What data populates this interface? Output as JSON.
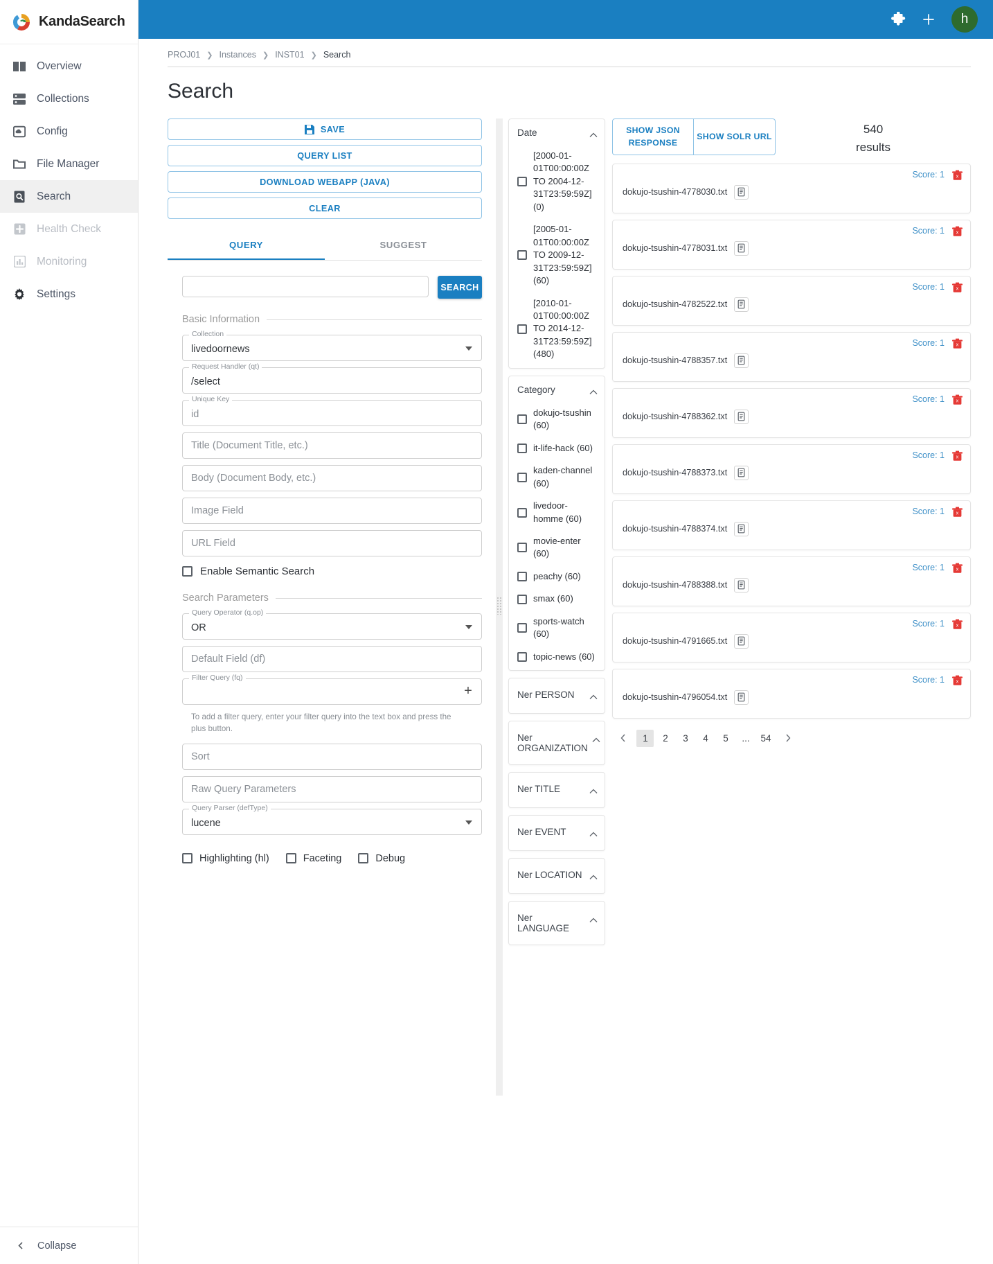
{
  "brand": {
    "name": "KandaSearch",
    "logo_icon": "kandasearch-logo-icon"
  },
  "sidebar": {
    "items": [
      {
        "label": "Overview",
        "icon": "book-icon",
        "state": "normal"
      },
      {
        "label": "Collections",
        "icon": "server-icon",
        "state": "normal"
      },
      {
        "label": "Config",
        "icon": "cloud-box-icon",
        "state": "normal"
      },
      {
        "label": "File Manager",
        "icon": "folder-icon",
        "state": "normal"
      },
      {
        "label": "Search",
        "icon": "doc-search-icon",
        "state": "active"
      },
      {
        "label": "Health Check",
        "icon": "plus-box-icon",
        "state": "disabled"
      },
      {
        "label": "Monitoring",
        "icon": "bar-chart-icon",
        "state": "disabled"
      },
      {
        "label": "Settings",
        "icon": "gear-icon",
        "state": "normal"
      }
    ],
    "collapse_label": "Collapse",
    "collapse_icon": "chevron-left-icon"
  },
  "topbar": {
    "puzzle_icon": "puzzle-piece-icon",
    "plus_icon": "plus-icon",
    "avatar_initial": "h",
    "avatar_color": "#2e6b2e",
    "bar_color": "#1a7fc1"
  },
  "breadcrumb": {
    "items": [
      "PROJ01",
      "Instances",
      "INST01",
      "Search"
    ]
  },
  "page": {
    "title": "Search"
  },
  "actions": {
    "save": "SAVE",
    "save_icon": "floppy-disk-icon",
    "query_list": "QUERY LIST",
    "download_webapp": "DOWNLOAD WEBAPP (JAVA)",
    "clear": "CLEAR"
  },
  "tabs": [
    {
      "label": "QUERY",
      "active": true
    },
    {
      "label": "SUGGEST",
      "active": false
    }
  ],
  "query_bar": {
    "input_value": "",
    "input_placeholder": "",
    "button": "SEARCH"
  },
  "sections": {
    "basic": "Basic Information",
    "params": "Search Parameters"
  },
  "basic_fields": [
    {
      "label": "Collection",
      "value": "livedoornews",
      "placeholder": "",
      "type": "select"
    },
    {
      "label": "Request Handler (qt)",
      "value": "/select",
      "placeholder": "",
      "type": "text"
    },
    {
      "label": "Unique Key",
      "value": "",
      "placeholder": "id",
      "type": "text"
    },
    {
      "label": "",
      "value": "",
      "placeholder": "Title (Document Title, etc.)",
      "type": "text"
    },
    {
      "label": "",
      "value": "",
      "placeholder": "Body (Document Body, etc.)",
      "type": "text"
    },
    {
      "label": "",
      "value": "",
      "placeholder": "Image Field",
      "type": "text"
    },
    {
      "label": "",
      "value": "",
      "placeholder": "URL Field",
      "type": "text"
    }
  ],
  "semantic_checkbox": {
    "label": "Enable Semantic Search",
    "checked": false
  },
  "param_fields": [
    {
      "label": "Query Operator (q.op)",
      "value": "OR",
      "placeholder": "",
      "type": "select"
    },
    {
      "label": "",
      "value": "",
      "placeholder": "Default Field (df)",
      "type": "text"
    },
    {
      "label": "Filter Query (fq)",
      "value": "",
      "placeholder": "",
      "type": "plus"
    },
    {
      "label": "",
      "value": "",
      "placeholder": "Sort",
      "type": "text"
    },
    {
      "label": "",
      "value": "",
      "placeholder": "Raw Query Parameters",
      "type": "text"
    },
    {
      "label": "Query Parser (defType)",
      "value": "lucene",
      "placeholder": "",
      "type": "select"
    }
  ],
  "filter_hint": "To add a filter query, enter your filter query into the text box and press the plus button.",
  "bottom_checkboxes": [
    {
      "label": "Highlighting (hl)",
      "checked": false
    },
    {
      "label": "Faceting",
      "checked": false
    },
    {
      "label": "Debug",
      "checked": false
    }
  ],
  "facets": [
    {
      "title": "Date",
      "expanded": true,
      "items": [
        {
          "label": "[2000-01-01T00:00:00Z TO 2004-12-31T23:59:59Z] (0)",
          "checked": false
        },
        {
          "label": "[2005-01-01T00:00:00Z TO 2009-12-31T23:59:59Z] (60)",
          "checked": false
        },
        {
          "label": "[2010-01-01T00:00:00Z TO 2014-12-31T23:59:59Z] (480)",
          "checked": false
        }
      ]
    },
    {
      "title": "Category",
      "expanded": true,
      "items": [
        {
          "label": "dokujo-tsushin (60)",
          "checked": false
        },
        {
          "label": "it-life-hack (60)",
          "checked": false
        },
        {
          "label": "kaden-channel (60)",
          "checked": false
        },
        {
          "label": "livedoor-homme (60)",
          "checked": false
        },
        {
          "label": "movie-enter (60)",
          "checked": false
        },
        {
          "label": "peachy (60)",
          "checked": false
        },
        {
          "label": "smax (60)",
          "checked": false
        },
        {
          "label": "sports-watch (60)",
          "checked": false
        },
        {
          "label": "topic-news (60)",
          "checked": false
        }
      ]
    },
    {
      "title": "Ner PERSON",
      "expanded": true,
      "items": []
    },
    {
      "title": "Ner ORGANIZATION",
      "expanded": true,
      "items": []
    },
    {
      "title": "Ner TITLE",
      "expanded": true,
      "items": []
    },
    {
      "title": "Ner EVENT",
      "expanded": true,
      "items": []
    },
    {
      "title": "Ner LOCATION",
      "expanded": true,
      "items": []
    },
    {
      "title": "Ner LANGUAGE",
      "expanded": true,
      "items": []
    }
  ],
  "results_header": {
    "show_json": "SHOW JSON RESPONSE",
    "show_solr": "SHOW SOLR URL",
    "count": "540",
    "count_unit": "results"
  },
  "results": [
    {
      "name": "dokujo-tsushin-4778030.txt",
      "score": "Score: 1"
    },
    {
      "name": "dokujo-tsushin-4778031.txt",
      "score": "Score: 1"
    },
    {
      "name": "dokujo-tsushin-4782522.txt",
      "score": "Score: 1"
    },
    {
      "name": "dokujo-tsushin-4788357.txt",
      "score": "Score: 1"
    },
    {
      "name": "dokujo-tsushin-4788362.txt",
      "score": "Score: 1"
    },
    {
      "name": "dokujo-tsushin-4788373.txt",
      "score": "Score: 1"
    },
    {
      "name": "dokujo-tsushin-4788374.txt",
      "score": "Score: 1"
    },
    {
      "name": "dokujo-tsushin-4788388.txt",
      "score": "Score: 1"
    },
    {
      "name": "dokujo-tsushin-4791665.txt",
      "score": "Score: 1"
    },
    {
      "name": "dokujo-tsushin-4796054.txt",
      "score": "Score: 1"
    }
  ],
  "pagination": {
    "prev_icon": "chevron-left-icon",
    "next_icon": "chevron-right-icon",
    "pages": [
      "1",
      "2",
      "3",
      "4",
      "5",
      "...",
      "54"
    ],
    "current": "1"
  }
}
